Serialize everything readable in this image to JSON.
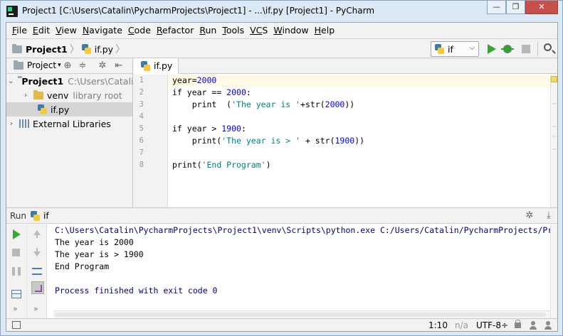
{
  "window": {
    "title": "Project1 [C:\\Users\\Catalin\\PycharmProjects\\Project1] - ...\\if.py [Project1] - PyCharm",
    "min_glyph": "—",
    "restore_glyph": "❐",
    "close_glyph": "✕"
  },
  "menu": [
    {
      "u": "F",
      "rest": "ile"
    },
    {
      "u": "E",
      "rest": "dit"
    },
    {
      "u": "V",
      "rest": "iew"
    },
    {
      "u": "N",
      "rest": "avigate"
    },
    {
      "u": "C",
      "rest": "ode"
    },
    {
      "u": "R",
      "rest": "efactor"
    },
    {
      "u": "R",
      "rest": "un"
    },
    {
      "u": "T",
      "rest": "ools"
    },
    {
      "u": "VC",
      "rest": "S"
    },
    {
      "u": "W",
      "rest": "indow"
    },
    {
      "u": "H",
      "rest": "elp"
    }
  ],
  "breadcrumb": {
    "project": "Project1",
    "file": "if.py",
    "sep": "〉"
  },
  "run_config": {
    "name": "if",
    "caret": "⌵"
  },
  "project_panel": {
    "tab_label": "Project",
    "tab_caret": "▾",
    "tree": {
      "root_name": "Project1",
      "root_path": "C:\\Users\\Catalin",
      "venv_name": "venv",
      "venv_note": "library root",
      "file_name": "if.py",
      "libs_name": "External Libraries"
    }
  },
  "editor": {
    "tab_label": "if.py",
    "line_numbers": [
      "1",
      "2",
      "3",
      "4",
      "5",
      "6",
      "7",
      "8"
    ]
  },
  "code": {
    "l1": {
      "a": "year=",
      "b": "2000"
    },
    "l2": {
      "a": "if year == ",
      "b": "2000",
      "c": ":"
    },
    "l3": {
      "a": "    print  (",
      "b": "'The year is '",
      "c": "+str(",
      "d": "2000",
      "e": "))"
    },
    "l5": {
      "a": "if year > ",
      "b": "1900",
      "c": ":"
    },
    "l6": {
      "a": "    print(",
      "b": "'The year is > '",
      "c": " + str(",
      "d": "1900",
      "e": "))"
    },
    "l8": {
      "a": "print(",
      "b": "'End Program'",
      "c": ")"
    }
  },
  "run_panel": {
    "label": "Run",
    "config": "if",
    "more": "»",
    "console": [
      "C:\\Users\\Catalin\\PycharmProjects\\Project1\\venv\\Scripts\\python.exe C:/Users/Catalin/PycharmProjects/Pr",
      "The year is 2000",
      "The year is > 1900",
      "End Program",
      "Process finished with exit code 0"
    ]
  },
  "statusbar": {
    "position": "1:10",
    "na": "n/a",
    "encoding": "UTF-8",
    "encoding_caret": "÷"
  },
  "colors": {
    "accent_run": "#3aa63a",
    "keyword": "#000080",
    "number": "#0000ff",
    "string": "#008080",
    "current_line": "#fffae3"
  }
}
